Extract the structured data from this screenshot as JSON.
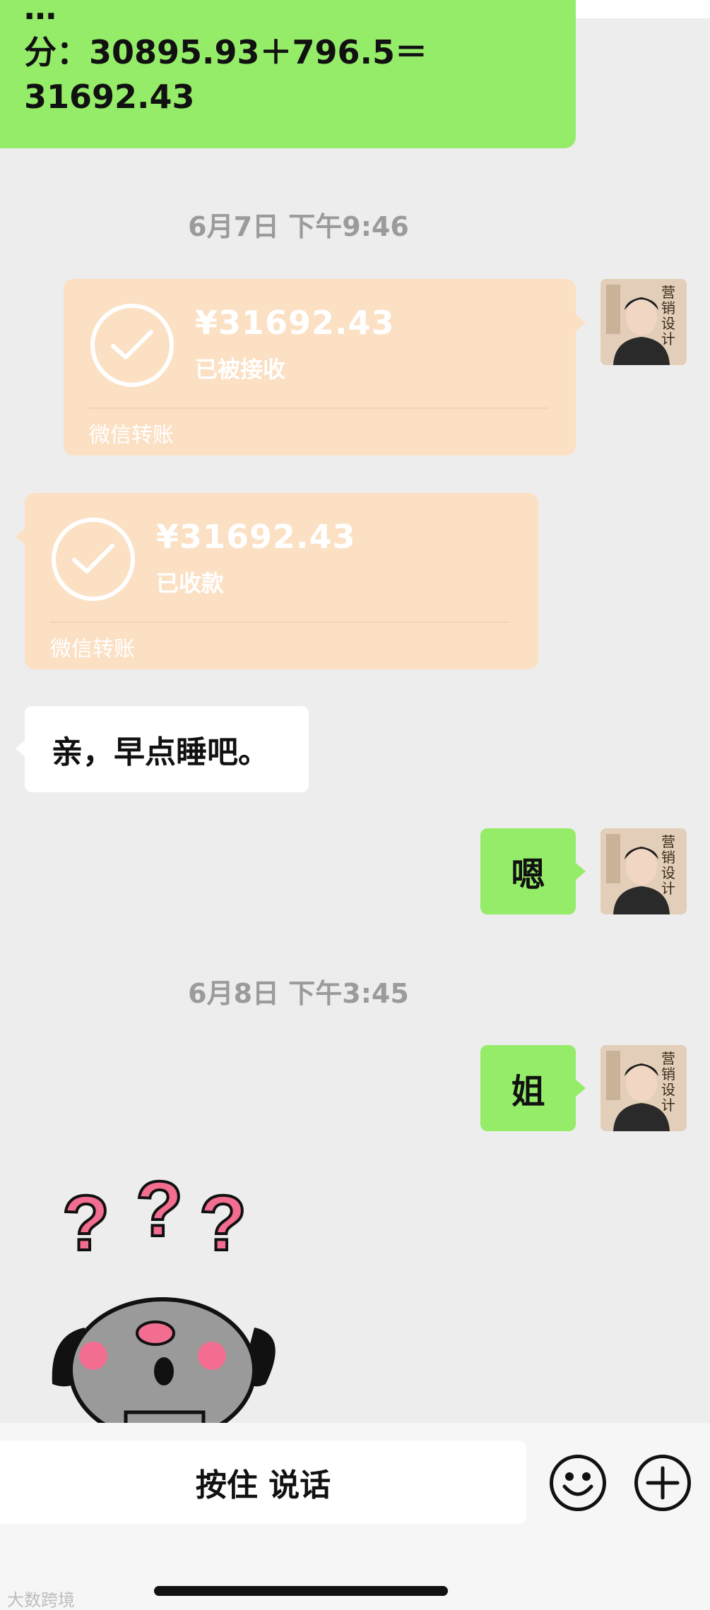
{
  "messages": {
    "top_green_partial": "…",
    "top_green_line1": "分：30895.93＋796.5＝",
    "top_green_line2": "31692.43",
    "timestamp1": "6月7日 下午9:46",
    "transfer_sent": {
      "amount": "¥31692.43",
      "status": "已被接收",
      "brand": "微信转账"
    },
    "transfer_received": {
      "amount": "¥31692.43",
      "status": "已收款",
      "brand": "微信转账"
    },
    "white_msg": "亲，早点睡吧。",
    "green_msg1": "嗯",
    "timestamp2": "6月8日 下午3:45",
    "green_msg2": "姐"
  },
  "avatar": {
    "text": "营销设计"
  },
  "sticker": {
    "marks": [
      "?",
      "?",
      "?"
    ]
  },
  "input_bar": {
    "voice_label": "按住 说话",
    "emoji_icon": "smiley-icon",
    "plus_icon": "plus-icon"
  },
  "watermark": "大数跨境",
  "colors": {
    "green_bubble": "#95ec69",
    "transfer_bubble": "#fbe0c4",
    "background": "#ededed"
  }
}
